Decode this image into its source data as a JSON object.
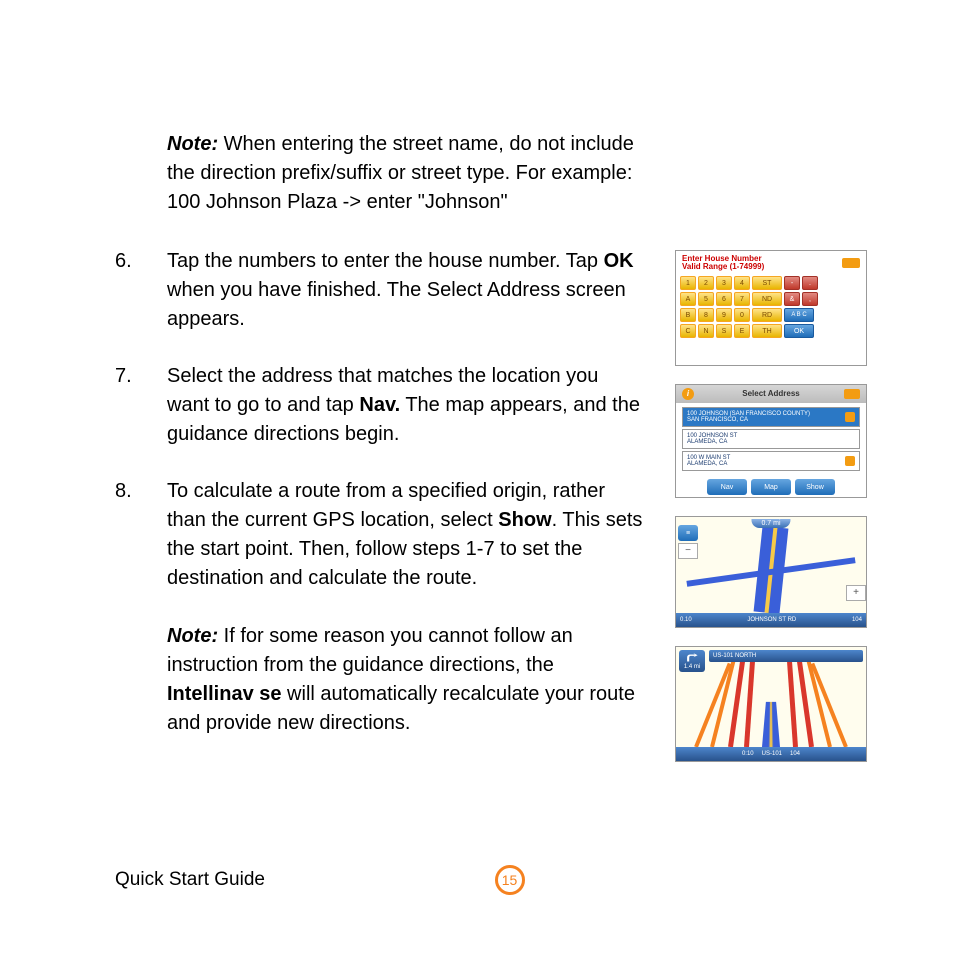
{
  "note1": {
    "label": "Note:",
    "text": "  When entering the street name, do not include the direction prefix/suffix or street type. For example:  100 Johnson Plaza -> enter \"Johnson\""
  },
  "steps": {
    "six": {
      "num": "6.",
      "a": "Tap the numbers to enter the house number. Tap ",
      "b_bold": "OK",
      "c": " when you have finished. The Select Address screen appears."
    },
    "seven": {
      "num": "7.",
      "a": "Select the address that matches the location you want to go to and tap ",
      "b_bold": "Nav.",
      "c": " The map appears, and the guidance directions begin."
    },
    "eight": {
      "num": "8.",
      "a": "To calculate a route from a specified origin, rather than the current GPS location, select ",
      "b_bold": "Show",
      "c": ".  This sets the start point.  Then, follow steps 1-7 to set the destination and calculate the route."
    }
  },
  "note2": {
    "label": "Note:",
    "a": "  If for some reason you cannot follow an instruction from the guidance directions, the ",
    "b_bold": "Intellinav se",
    "c": " will automatically recalculate your route and provide new directions."
  },
  "thumbs": {
    "t1": {
      "title_l1": "Enter House Number",
      "title_l2": "Valid Range (1-74999)",
      "r1": [
        "1",
        "2",
        "3",
        "4",
        "ST"
      ],
      "r1_sp": [
        "-",
        "."
      ],
      "r2": [
        "A",
        "5",
        "6",
        "7",
        "ND"
      ],
      "r2_sp": [
        "&",
        ","
      ],
      "r3": [
        "B",
        "8",
        "9",
        "0",
        "RD"
      ],
      "r3_sp": "A B C",
      "r4": [
        "C",
        "N",
        "S",
        "E",
        "TH"
      ],
      "r4_sp": "OK"
    },
    "t2": {
      "title": "Select Address",
      "items": [
        {
          "l1": "100 JOHNSON (SAN FRANCISCO COUNTY)",
          "l2": "SAN FRANCISCO, CA"
        },
        {
          "l1": "100 JOHNSON ST",
          "l2": "ALAMEDA, CA"
        },
        {
          "l1": "100 W MAIN ST",
          "l2": "ALAMEDA, CA"
        }
      ],
      "btns": [
        "Nav",
        "Map",
        "Show"
      ]
    },
    "t3": {
      "top": "0.7 mi",
      "bottom_l": "0.10",
      "bottom_c": "JOHNSON ST RD",
      "bottom_r": "104"
    },
    "t4": {
      "dist": "1.4 mi",
      "bar": "US-101 NORTH",
      "bot_l": "0:10",
      "bot_c": "US-101",
      "bot_r": "104"
    }
  },
  "footer": {
    "label": "Quick Start Guide",
    "page": "15"
  }
}
